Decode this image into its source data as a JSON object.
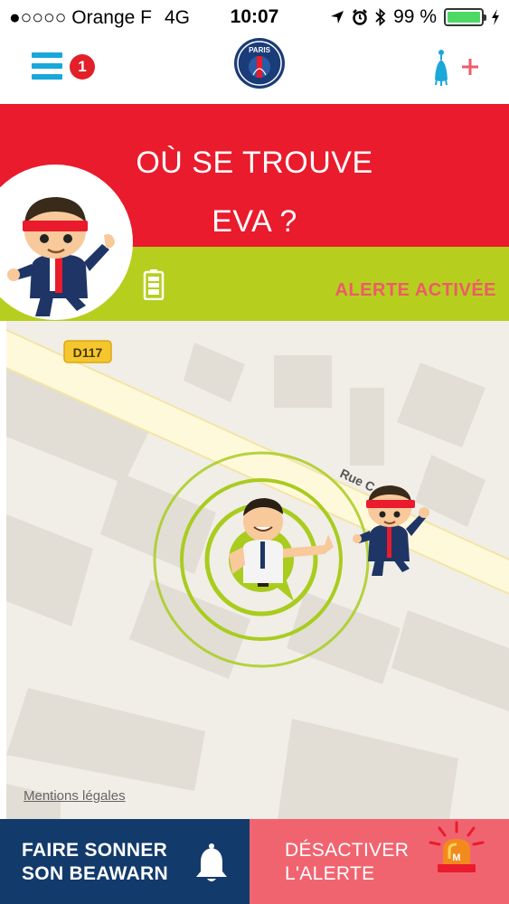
{
  "status_bar": {
    "carrier": "●○○○○ Orange F",
    "network": "4G",
    "time": "10:07",
    "battery_percent": "99 %",
    "battery_level": 0.99
  },
  "nav": {
    "notification_count": "1",
    "logo_text": "PARIS",
    "menu_icon": "hamburger-menu-icon",
    "add_device_icon": "add-device-icon"
  },
  "header": {
    "title_line1": "OÙ SE TROUVE",
    "title_line2": "EVA ?",
    "alert_status": "ALERTE ACTIVÉE"
  },
  "map": {
    "road_label": "D117",
    "street_label": "Rue C",
    "mentions": "Mentions légales"
  },
  "actions": {
    "ring_line1": "FAIRE SONNER",
    "ring_line2": "SON BEAWARN",
    "deactivate_line1": "DÉSACTIVER",
    "deactivate_line2": "L'ALERTE"
  },
  "colors": {
    "red": "#e91b2c",
    "green": "#b6cf1f",
    "navy": "#123a6b",
    "coral": "#f06470",
    "blue": "#1aa7d9"
  }
}
